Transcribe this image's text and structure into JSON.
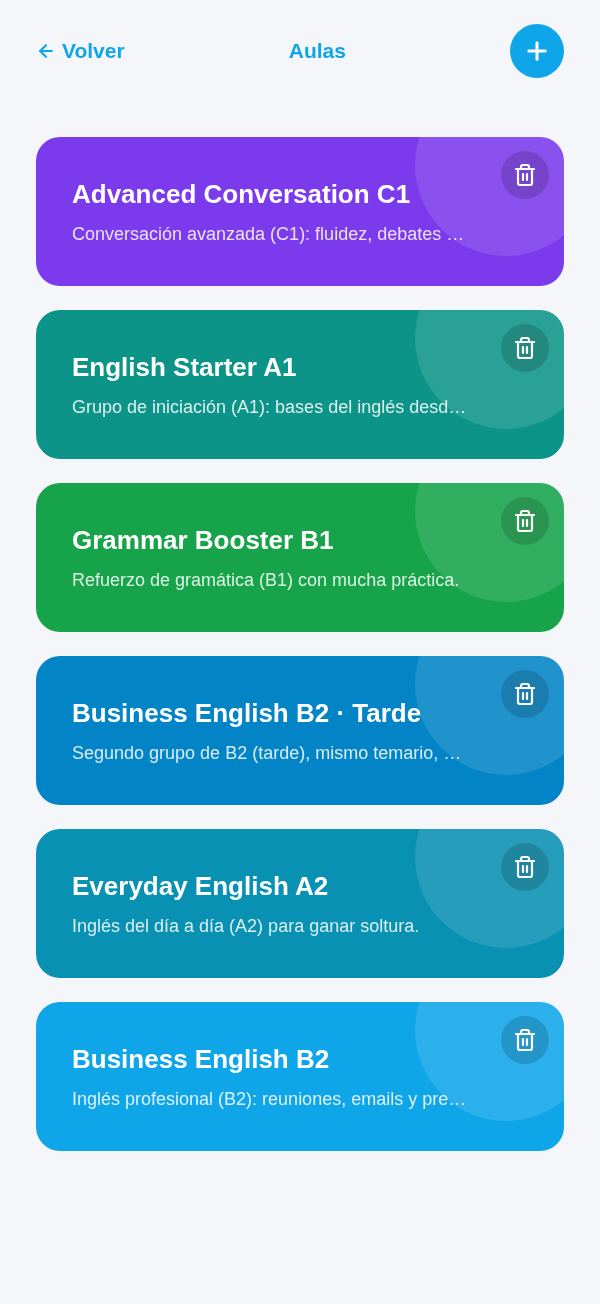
{
  "header": {
    "back_link": {
      "label": "Volver"
    },
    "title": "Aulas"
  },
  "classes": [
    {
      "title": "Advanced Conversation C1",
      "description": "Conversación avanzada (C1): fluidez, debates …",
      "color": "#7c3aed"
    },
    {
      "title": "English Starter A1",
      "description": "Grupo de iniciación (A1): bases del inglés desd…",
      "color": "#0d9488"
    },
    {
      "title": "Grammar Booster B1",
      "description": "Refuerzo de gramática (B1) con mucha práctica.",
      "color": "#16a34a"
    },
    {
      "title": "Business English B2 · Tarde",
      "description": "Segundo grupo de B2 (tarde), mismo temario, …",
      "color": "#0284c7"
    },
    {
      "title": "Everyday English A2",
      "description": "Inglés del día a día (A2) para ganar soltura.",
      "color": "#0891b2"
    },
    {
      "title": "Business English B2",
      "description": "Inglés profesional (B2): reuniones, emails y pre…",
      "color": "#0ea5e9"
    }
  ]
}
